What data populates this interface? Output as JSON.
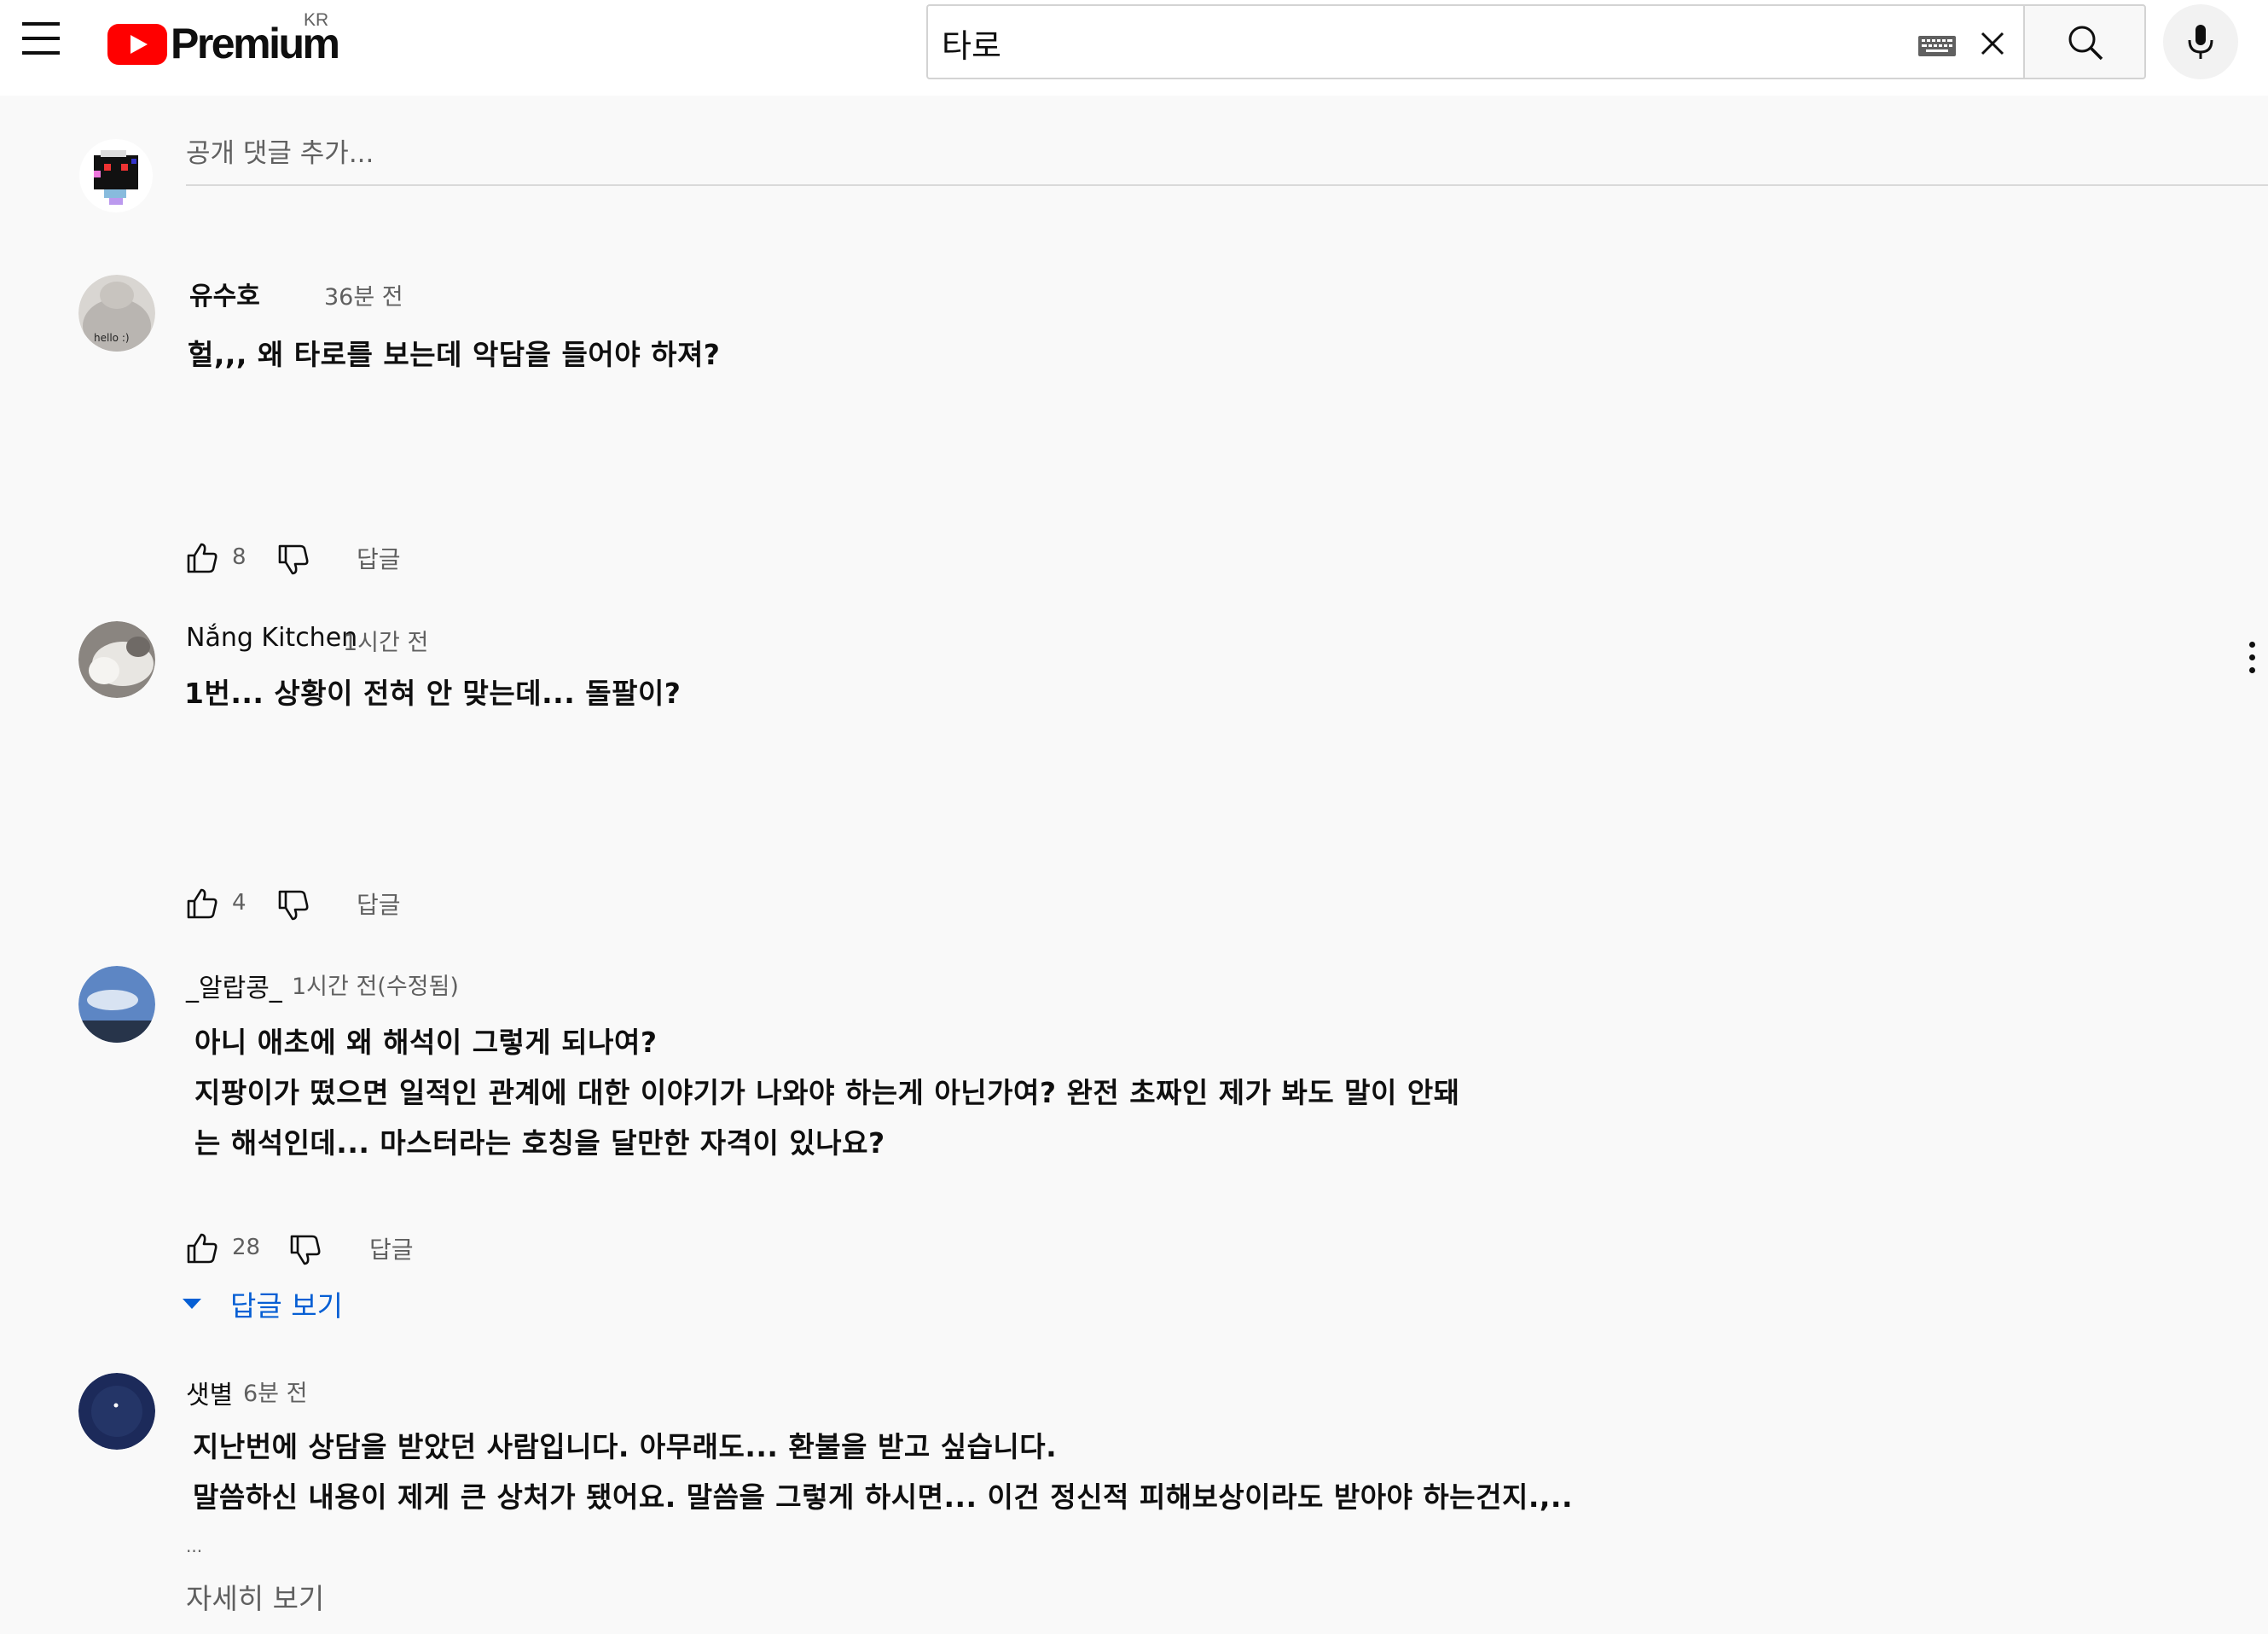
{
  "header": {
    "logo_text": "Premium",
    "country_code": "KR",
    "search_value": "타로"
  },
  "add_comment": {
    "placeholder": "공개 댓글 추가..."
  },
  "comments": [
    {
      "author": "유수호",
      "time": "36분 전",
      "lines": [
        "헐,,, 왜 타로를 보는데 악담을 들어야 하져?"
      ],
      "likes": "8",
      "reply_label": "답글"
    },
    {
      "author": "Nắng Kitchen",
      "time": "1시간 전",
      "lines": [
        "1번... 상황이 전혀 안 맞는데... 돌팔이?"
      ],
      "likes": "4",
      "reply_label": "답글"
    },
    {
      "author": "_알랍콩_",
      "time": "1시간 전(수정됨)",
      "lines": [
        "아니 애초에 왜 해석이 그렇게 되나여?",
        "지팡이가 떴으면 일적인 관계에 대한 이야기가 나와야 하는게 아닌가여? 완전 초짜인 제가 봐도 말이 안돼",
        "는 해석인데... 마스터라는 호칭을 달만한 자격이 있나요?"
      ],
      "likes": "28",
      "reply_label": "답글",
      "view_replies_label": "답글 보기"
    },
    {
      "author": "샛별",
      "time": "6분 전",
      "lines": [
        "지난번에 상담을 받았던 사람입니다. 아무래도... 환불을 받고 싶습니다.",
        "말씀하신 내용이 제게 큰 상처가 됐어요. 말씀을 그렇게 하시면... 이건 정신적 피해보상이라도 받아야 하는건지.,..",
        "..."
      ],
      "show_more_label": "자세히 보기"
    }
  ]
}
